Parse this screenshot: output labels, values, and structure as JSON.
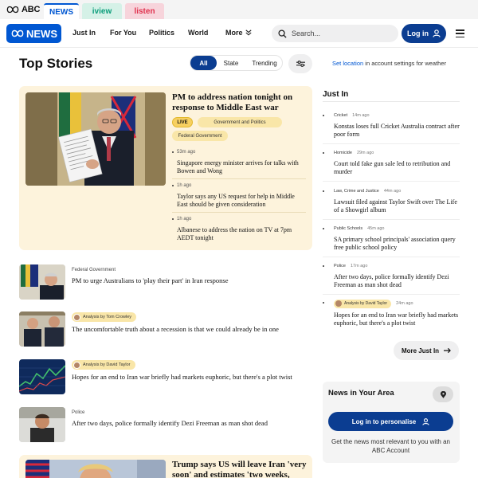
{
  "brand": {
    "abc_logo_text": "ABC",
    "tabs": [
      {
        "label": "NEWS",
        "color": "#0057d2"
      },
      {
        "label": "iview",
        "color": "#0c9e7b"
      },
      {
        "label": "listen",
        "color": "#e0324e"
      }
    ]
  },
  "nav": {
    "logo_text": "NEWS",
    "items": [
      "Just In",
      "For You",
      "Politics",
      "World"
    ],
    "more_label": "More",
    "search_placeholder": "Search...",
    "login_label": "Log in",
    "menu_icon": "hamburger-icon"
  },
  "top_stories": {
    "title": "Top Stories",
    "filters": [
      "All",
      "State",
      "Trending"
    ],
    "active_filter": "All",
    "weather_link": "Set location",
    "weather_text": " in account settings for weather"
  },
  "hero": {
    "title": "PM to address nation tonight on response to Middle East war",
    "live_label": "LIVE",
    "topics": [
      "Government and Politics",
      "Federal Government"
    ],
    "sub_stories": [
      {
        "time": "53m ago",
        "headline": "Singapore energy minister arrives for talks with Bowen and Wong"
      },
      {
        "time": "1h ago",
        "headline": "Taylor says any US request for help in Middle East should be given consideration"
      },
      {
        "time": "1h ago",
        "headline": "Albanese to address the nation on TV at 7pm AEDT tonight"
      }
    ]
  },
  "stories": [
    {
      "topic": "Federal Government",
      "analysis": "",
      "headline": "PM to urge Australians to 'play their part' in Iran response"
    },
    {
      "topic": "",
      "analysis": "Analysis by Tom Crowley",
      "headline": "The uncomfortable truth about a recession is that we could already be in one"
    },
    {
      "topic": "",
      "analysis": "Analysis by David Taylor",
      "headline": "Hopes for an end to Iran war briefly had markets euphoric, but there's a plot twist"
    },
    {
      "topic": "Police",
      "analysis": "",
      "headline": "After two days, police formally identify Dezi Freeman as man shot dead"
    }
  ],
  "hero2": {
    "title": "Trump says US will leave Iran 'very soon' and estimates 'two weeks,"
  },
  "just_in": {
    "title": "Just In",
    "items": [
      {
        "topic": "Cricket",
        "ago": "14m ago",
        "analysis": "",
        "headline": "Konstas loses full Cricket Australia contract after poor form"
      },
      {
        "topic": "Homicide",
        "ago": "29m ago",
        "analysis": "",
        "headline": "Court told fake gun sale led to retribution and murder"
      },
      {
        "topic": "Law, Crime and Justice",
        "ago": "44m ago",
        "analysis": "",
        "headline": "Lawsuit filed against Taylor Swift over The Life of a Showgirl album"
      },
      {
        "topic": "Public Schools",
        "ago": "45m ago",
        "analysis": "",
        "headline": "SA primary school principals' association query free public school policy"
      },
      {
        "topic": "Police",
        "ago": "17m ago",
        "analysis": "",
        "headline": "After two days, police formally identify Dezi Freeman as man shot dead"
      },
      {
        "topic": "",
        "ago": "24m ago",
        "analysis": "Analysis by David Taylor",
        "headline": "Hopes for an end to Iran war briefly had markets euphoric, but there's a plot twist"
      }
    ],
    "more_label": "More Just In"
  },
  "area": {
    "title": "News in Your Area",
    "button_label": "Log in to personalise",
    "text": "Get the news most relevant to you with an ABC Account"
  },
  "colors": {
    "accent": "#0057d2",
    "navy": "#0b3d91",
    "card": "#fdf3dc",
    "pill": "#f9e6a8"
  }
}
